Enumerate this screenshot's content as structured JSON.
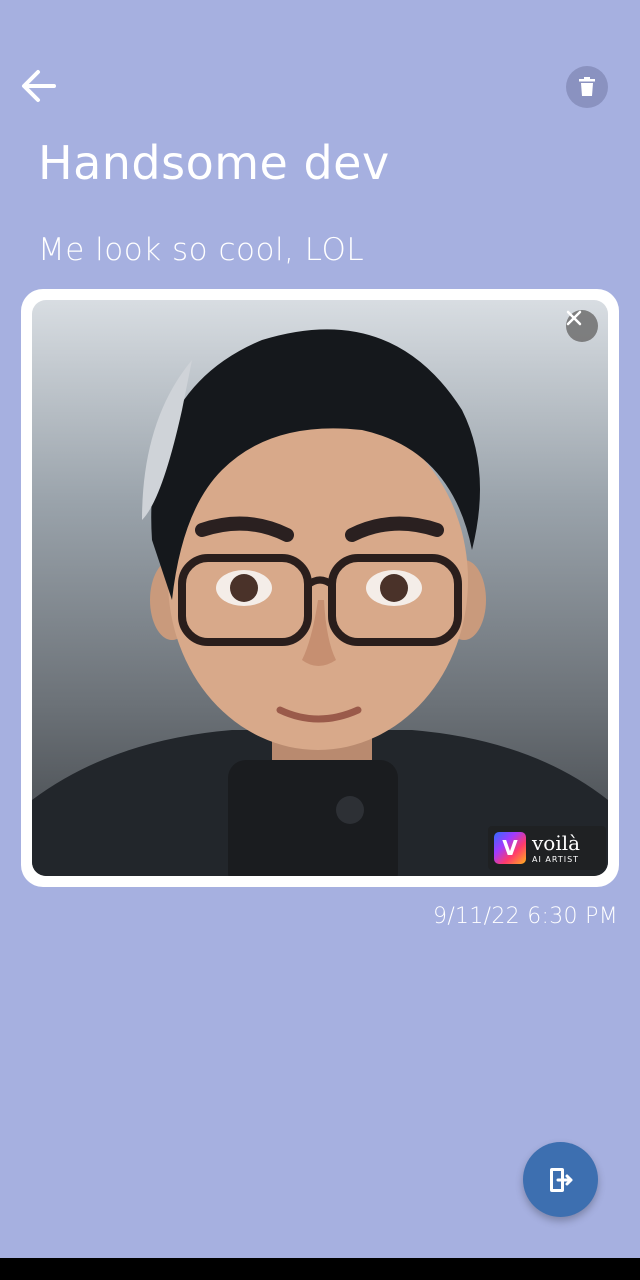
{
  "header": {
    "back_icon": "arrow-left-icon",
    "delete_icon": "trash-icon"
  },
  "note": {
    "title": "Handsome dev",
    "body": "Me look so cool, LOL",
    "timestamp": "9/11/22 6:30 PM"
  },
  "image": {
    "remove_icon": "close-icon",
    "watermark": {
      "brand": "voilà",
      "tagline": "AI ARTIST",
      "logo_letter": "V"
    }
  },
  "fab": {
    "icon": "export-icon"
  },
  "colors": {
    "background": "#a6b0e0",
    "fab": "#3d6fb0",
    "delete_button": "#8a92c0"
  }
}
